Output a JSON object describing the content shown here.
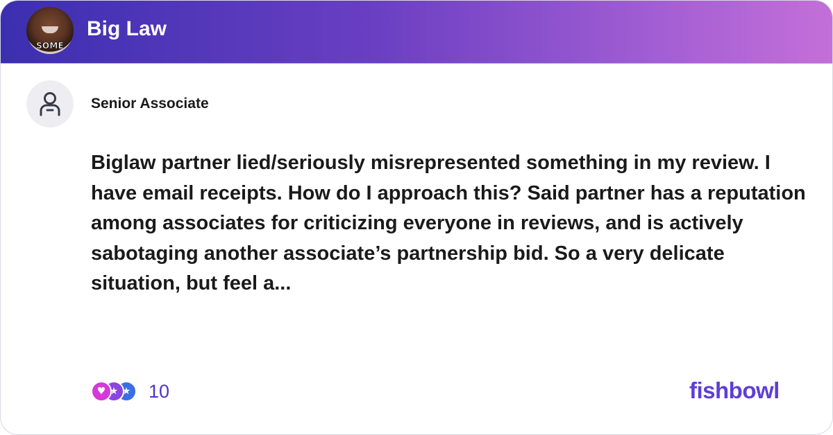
{
  "header": {
    "group_name": "Big Law",
    "group_avatar_caption": "SOME"
  },
  "post": {
    "author_title": "Senior Associate",
    "body": "Biglaw partner lied/seriously misrepresented something in my review.  I have email receipts.  How do I approach this?  Said partner has a reputation among associates for criticizing everyone in reviews, and is actively sabotaging another associate’s partnership bid.  So a very delicate situation, but feel a..."
  },
  "footer": {
    "reaction_icons": [
      "heart-reaction-icon",
      "star-reaction-icon",
      "star-reaction-icon"
    ],
    "reaction_count": "10",
    "brand": "fishbowl"
  },
  "colors": {
    "header_gradient_start": "#3b2fb0",
    "header_gradient_end": "#c46fd8",
    "accent": "#5b3fd6",
    "text": "#1a1a1a"
  }
}
